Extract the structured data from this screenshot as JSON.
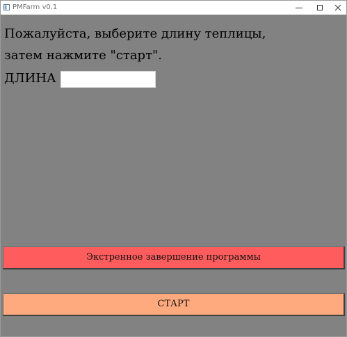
{
  "window": {
    "title": "PMFarm v0.1"
  },
  "prompt": {
    "line1": "Пожалуйста, выберите длину теплицы,",
    "line2": "затем нажмите \"старт\"."
  },
  "length_field": {
    "label": "ДЛИНА",
    "value": ""
  },
  "buttons": {
    "emergency_label": "Экстренное завершение программы",
    "start_label": "СТАРТ"
  },
  "colors": {
    "background": "#828282",
    "emergency_button": "#ff5d5d",
    "start_button": "#ffaa7e"
  },
  "icons": {
    "app": "window-app-icon",
    "minimize": "minimize-icon",
    "maximize": "maximize-icon",
    "close": "close-icon"
  }
}
